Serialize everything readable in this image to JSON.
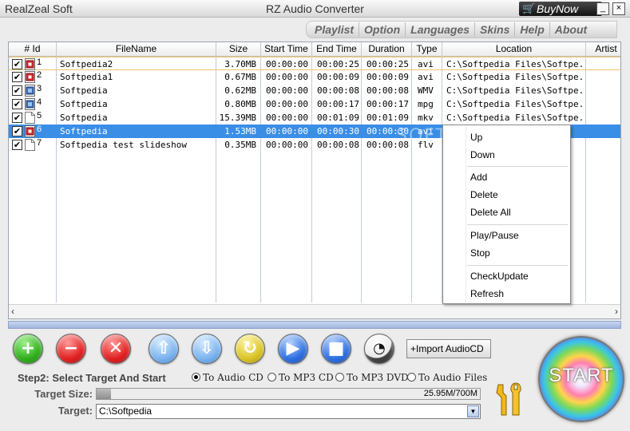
{
  "window": {
    "brand": "RealZeal Soft",
    "title": "RZ Audio Converter",
    "buynow_label": "BuyNow",
    "minimize_label": "_",
    "close_label": "×"
  },
  "menu": [
    "Playlist",
    "Option",
    "Languages",
    "Skins",
    "Help",
    "About"
  ],
  "table": {
    "columns": [
      "# Id",
      "FileName",
      "Size",
      "Start Time",
      "End Time",
      "Duration",
      "Type",
      "Location",
      "Artist"
    ],
    "rows": [
      {
        "id": "1",
        "filename": "Softpedia2",
        "size": "3.70MB",
        "start": "00:00:00",
        "end": "00:00:25",
        "duration": "00:00:25",
        "type": "avi",
        "location": "C:\\Softpedia Files\\Softpe...",
        "icon": "video-file-icon",
        "checked": true
      },
      {
        "id": "2",
        "filename": "Softpedia1",
        "size": "0.67MB",
        "start": "00:00:00",
        "end": "00:00:09",
        "duration": "00:00:09",
        "type": "avi",
        "location": "C:\\Softpedia Files\\Softpe...",
        "icon": "video-file-icon",
        "checked": true
      },
      {
        "id": "3",
        "filename": "Softpedia",
        "size": "0.62MB",
        "start": "00:00:00",
        "end": "00:00:08",
        "duration": "00:00:08",
        "type": "WMV",
        "location": "C:\\Softpedia Files\\Softpe...",
        "icon": "media-file-icon",
        "checked": true
      },
      {
        "id": "4",
        "filename": "Softpedia",
        "size": "0.80MB",
        "start": "00:00:00",
        "end": "00:00:17",
        "duration": "00:00:17",
        "type": "mpg",
        "location": "C:\\Softpedia Files\\Softpe...",
        "icon": "media-file-icon",
        "checked": true
      },
      {
        "id": "5",
        "filename": "Softpedia",
        "size": "15.39MB",
        "start": "00:00:00",
        "end": "00:01:09",
        "duration": "00:01:09",
        "type": "mkv",
        "location": "C:\\Softpedia Files\\Softpe...",
        "icon": "blank-file-icon",
        "checked": true
      },
      {
        "id": "6",
        "filename": "Softpedia",
        "size": "1.53MB",
        "start": "00:00:00",
        "end": "00:00:30",
        "duration": "00:00:30",
        "type": "avi",
        "location": "",
        "icon": "video-file-icon",
        "checked": true
      },
      {
        "id": "7",
        "filename": "Softpedia test slideshow",
        "size": "0.35MB",
        "start": "00:00:00",
        "end": "00:00:08",
        "duration": "00:00:08",
        "type": "flv",
        "location": "",
        "icon": "blank-file-icon",
        "checked": true
      }
    ]
  },
  "watermark": "SOFTPEDIA",
  "context_menu": {
    "items": [
      "Up",
      "Down",
      "Add",
      "Delete",
      "Delete All",
      "Play/Pause",
      "Stop",
      "CheckUpdate",
      "Refresh"
    ]
  },
  "toolbar": {
    "buttons": [
      "add-button",
      "remove-button",
      "delete-button",
      "move-up-button",
      "move-down-button",
      "refresh-button",
      "play-button",
      "stop-button",
      "timer-button"
    ],
    "import_label": "Import AudioCD"
  },
  "step2": {
    "title": "Step2: Select Target And Start",
    "options": [
      "To Audio CD",
      "To MP3 CD",
      "To MP3 DVD",
      "To Audio Files"
    ],
    "selected": "To Audio CD"
  },
  "target_size": {
    "label": "Target Size:",
    "text": "25.95M/700M",
    "fraction": 0.037
  },
  "target": {
    "label": "Target:",
    "value": "C:\\Softpedia"
  },
  "start_label": "START"
}
